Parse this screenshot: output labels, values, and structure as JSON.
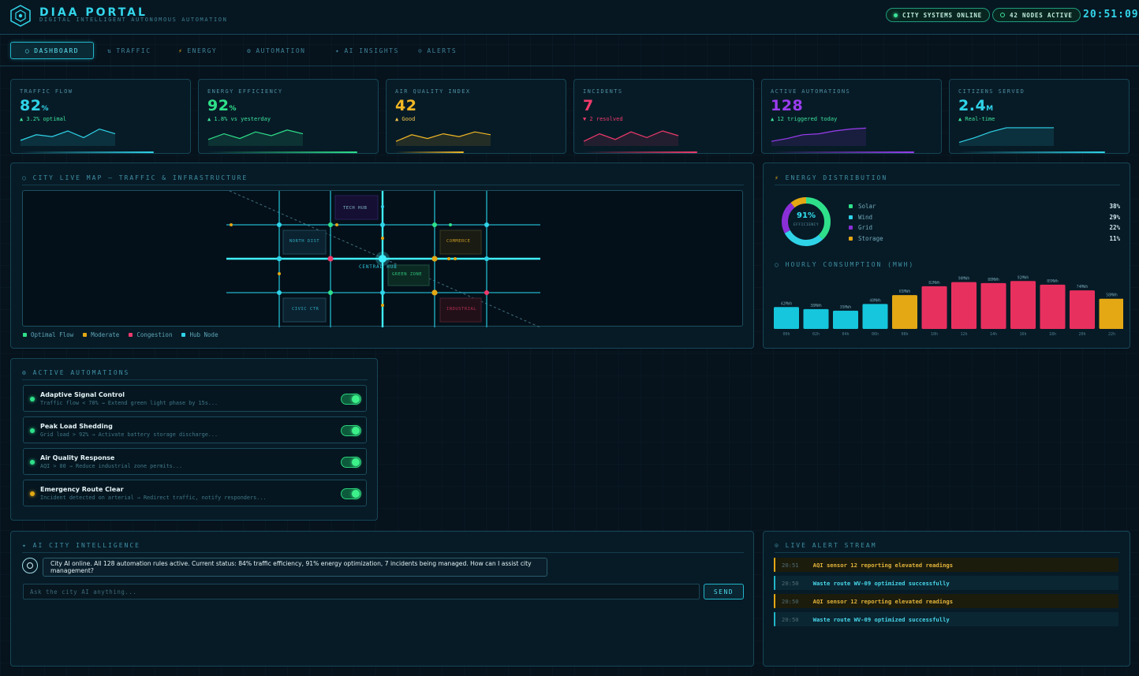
{
  "header": {
    "brand": "DIAA PORTAL",
    "subtitle": "DIGITAL INTELLIGENT AUTONOMOUS AUTOMATION",
    "status_online": "CITY SYSTEMS ONLINE",
    "status_nodes": "42 NODES ACTIVE",
    "clock": "20:51:09"
  },
  "nav": {
    "tabs": [
      {
        "label": "DASHBOARD",
        "icon": "circle-icon",
        "glyph": "○",
        "active": true
      },
      {
        "label": "TRAFFIC",
        "icon": "traffic-icon",
        "glyph": "⇅",
        "active": false
      },
      {
        "label": "ENERGY",
        "icon": "bolt-icon",
        "glyph": "⚡",
        "active": false
      },
      {
        "label": "AUTOMATION",
        "icon": "gear-icon",
        "glyph": "⚙",
        "active": false
      },
      {
        "label": "AI INSIGHTS",
        "icon": "sparkle-icon",
        "glyph": "✦",
        "active": false
      },
      {
        "label": "ALERTS",
        "icon": "alert-icon",
        "glyph": "⊙",
        "active": false
      }
    ]
  },
  "kpis": [
    {
      "label": "TRAFFIC FLOW",
      "value": "82",
      "unit": "%",
      "trend": "▲ 3.2% optimal",
      "color": "#2fd3e8",
      "trend_color": "#3de39a",
      "spark": [
        0.25,
        0.55,
        0.45,
        0.75,
        0.4,
        0.85,
        0.6
      ],
      "fill": 0.82
    },
    {
      "label": "ENERGY EFFICIENCY",
      "value": "92",
      "unit": "%",
      "trend": "▲ 1.8% vs yesterday",
      "color": "#2fe08a",
      "trend_color": "#3de39a",
      "spark": [
        0.3,
        0.6,
        0.35,
        0.7,
        0.5,
        0.8,
        0.6
      ],
      "fill": 0.92
    },
    {
      "label": "AIR QUALITY INDEX",
      "value": "42",
      "unit": "",
      "trend": "▲ Good",
      "color": "#f2b824",
      "trend_color": "#f2c84a",
      "spark": [
        0.2,
        0.55,
        0.35,
        0.6,
        0.45,
        0.7,
        0.55
      ],
      "fill": 0.42
    },
    {
      "label": "INCIDENTS",
      "value": "7",
      "unit": "",
      "trend": "▼ 2 resolved",
      "color": "#f03a6b",
      "trend_color": "#f03a6b",
      "spark": [
        0.2,
        0.6,
        0.3,
        0.7,
        0.4,
        0.75,
        0.5
      ],
      "fill": 0.7
    },
    {
      "label": "ACTIVE AUTOMATIONS",
      "value": "128",
      "unit": "",
      "trend": "▲ 12 triggered today",
      "color": "#9b3df0",
      "trend_color": "#3de39a",
      "spark": [
        0.2,
        0.35,
        0.55,
        0.6,
        0.75,
        0.85,
        0.9
      ],
      "fill": 0.88
    },
    {
      "label": "CITIZENS SERVED",
      "value": "2.4",
      "unit": "M",
      "trend": "▲ Real-time",
      "color": "#2fd3e8",
      "trend_color": "#3de39a",
      "spark": [
        0.15,
        0.4,
        0.7,
        0.92,
        0.92,
        0.92,
        0.92
      ],
      "fill": 0.9
    }
  ],
  "map": {
    "title": "CITY LIVE MAP — TRAFFIC & INFRASTRUCTURE",
    "districts": [
      {
        "label": "TECH HUB",
        "color": "#5b2fa8"
      },
      {
        "label": "NORTH DIST",
        "color": "#2fd3e8"
      },
      {
        "label": "COMMERCE",
        "color": "#e3a814"
      },
      {
        "label": "CENTRAL HUB",
        "color": "#2fd3e8"
      },
      {
        "label": "GREEN ZONE",
        "color": "#2fe08a"
      },
      {
        "label": "CIVIC CTR",
        "color": "#2fd3e8"
      },
      {
        "label": "INDUSTRIAL",
        "color": "#f03a6b"
      }
    ],
    "legend": [
      {
        "label": "Optimal Flow",
        "color": "#2fe08a"
      },
      {
        "label": "Moderate",
        "color": "#e3a814"
      },
      {
        "label": "Congestion",
        "color": "#f03a6b"
      },
      {
        "label": "Hub Node",
        "color": "#2fd3e8"
      }
    ]
  },
  "energy": {
    "title": "ENERGY DISTRIBUTION",
    "donut_value": "91%",
    "donut_label": "EFFICIENCY",
    "sources": [
      {
        "label": "Solar",
        "pct": "38%",
        "value": 38,
        "color": "#2fe08a"
      },
      {
        "label": "Wind",
        "pct": "29%",
        "value": 29,
        "color": "#2fd3e8"
      },
      {
        "label": "Grid",
        "pct": "22%",
        "value": 22,
        "color": "#8a2fd8"
      },
      {
        "label": "Storage",
        "pct": "11%",
        "value": 11,
        "color": "#e3a814"
      }
    ]
  },
  "chart_data": {
    "type": "bar",
    "title": "HOURLY CONSUMPTION (MWH)",
    "categories": [
      "00h",
      "02h",
      "04h",
      "06h",
      "08h",
      "10h",
      "12h",
      "14h",
      "16h",
      "18h",
      "20h",
      "22h"
    ],
    "values": [
      42,
      38,
      35,
      48,
      65,
      82,
      90,
      88,
      92,
      85,
      74,
      58
    ],
    "value_labels": [
      "42MWh",
      "38MWh",
      "35MWh",
      "48MWh",
      "65MWh",
      "82MWh",
      "90MWh",
      "88MWh",
      "92MWh",
      "85MWh",
      "74MWh",
      "58MWh"
    ],
    "ylim": [
      0,
      100
    ],
    "colors": [
      "#16c6dc",
      "#16c6dc",
      "#16c6dc",
      "#16c6dc",
      "#e3a814",
      "#e8305f",
      "#e8305f",
      "#e8305f",
      "#e8305f",
      "#e8305f",
      "#e8305f",
      "#e3a814"
    ]
  },
  "automations": {
    "title": "ACTIVE AUTOMATIONS",
    "items": [
      {
        "name": "Adaptive Signal Control",
        "desc": "Traffic flow < 70% → Extend green light phase by 15s...",
        "status_color": "#2fe08a"
      },
      {
        "name": "Peak Load Shedding",
        "desc": "Grid load > 92% → Activate battery storage discharge...",
        "status_color": "#2fe08a"
      },
      {
        "name": "Air Quality Response",
        "desc": "AQI > 80 → Reduce industrial zone permits...",
        "status_color": "#2fe08a"
      },
      {
        "name": "Emergency Route Clear",
        "desc": "Incident detected on arterial → Redirect traffic, notify responders...",
        "status_color": "#e3a814"
      }
    ]
  },
  "chat": {
    "title": "AI CITY INTELLIGENCE",
    "message": "City AI online. All 128 automation rules active. Current status: 84% traffic efficiency, 91% energy optimization, 7 incidents being managed. How can I assist city management?",
    "placeholder": "Ask the city AI anything...",
    "send_label": "SEND"
  },
  "alerts": {
    "title": "LIVE ALERT STREAM",
    "items": [
      {
        "time": "20:51",
        "text": "AQI sensor 12 reporting elevated readings",
        "level": "warn"
      },
      {
        "time": "20:50",
        "text": "Waste route WV-09 optimized successfully",
        "level": "ok"
      },
      {
        "time": "20:50",
        "text": "AQI sensor 12 reporting elevated readings",
        "level": "warn"
      },
      {
        "time": "20:50",
        "text": "Waste route WV-09 optimized successfully",
        "level": "ok"
      }
    ]
  }
}
